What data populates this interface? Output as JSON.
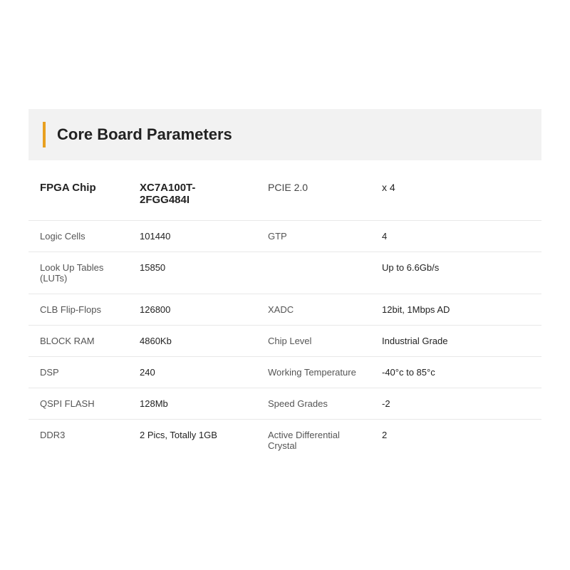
{
  "header": {
    "title": "Core Board Parameters",
    "accent_color": "#e8a020"
  },
  "rows": [
    {
      "label1": "FPGA Chip",
      "value1": "XC7A100T-2FGG484I",
      "label2": "PCIE 2.0",
      "value2": "x 4",
      "is_fpga": true
    },
    {
      "label1": "Logic Cells",
      "value1": "101440",
      "label2": "GTP",
      "value2": "4"
    },
    {
      "label1": "Look Up Tables (LUTs)",
      "value1": "15850",
      "label2": "",
      "value2": "Up to 6.6Gb/s"
    },
    {
      "label1": "CLB Flip-Flops",
      "value1": "126800",
      "label2": "XADC",
      "value2": "12bit, 1Mbps AD"
    },
    {
      "label1": "BLOCK RAM",
      "value1": "4860Kb",
      "label2": "Chip Level",
      "value2": "Industrial Grade"
    },
    {
      "label1": "DSP",
      "value1": "240",
      "label2": "Working Temperature",
      "value2": "-40°c to 85°c"
    },
    {
      "label1": "QSPI FLASH",
      "value1": "128Mb",
      "label2": "Speed Grades",
      "value2": "-2"
    },
    {
      "label1": "DDR3",
      "value1": "2 Pics, Totally 1GB",
      "label2": "Active Differential Crystal",
      "value2": "2"
    }
  ]
}
